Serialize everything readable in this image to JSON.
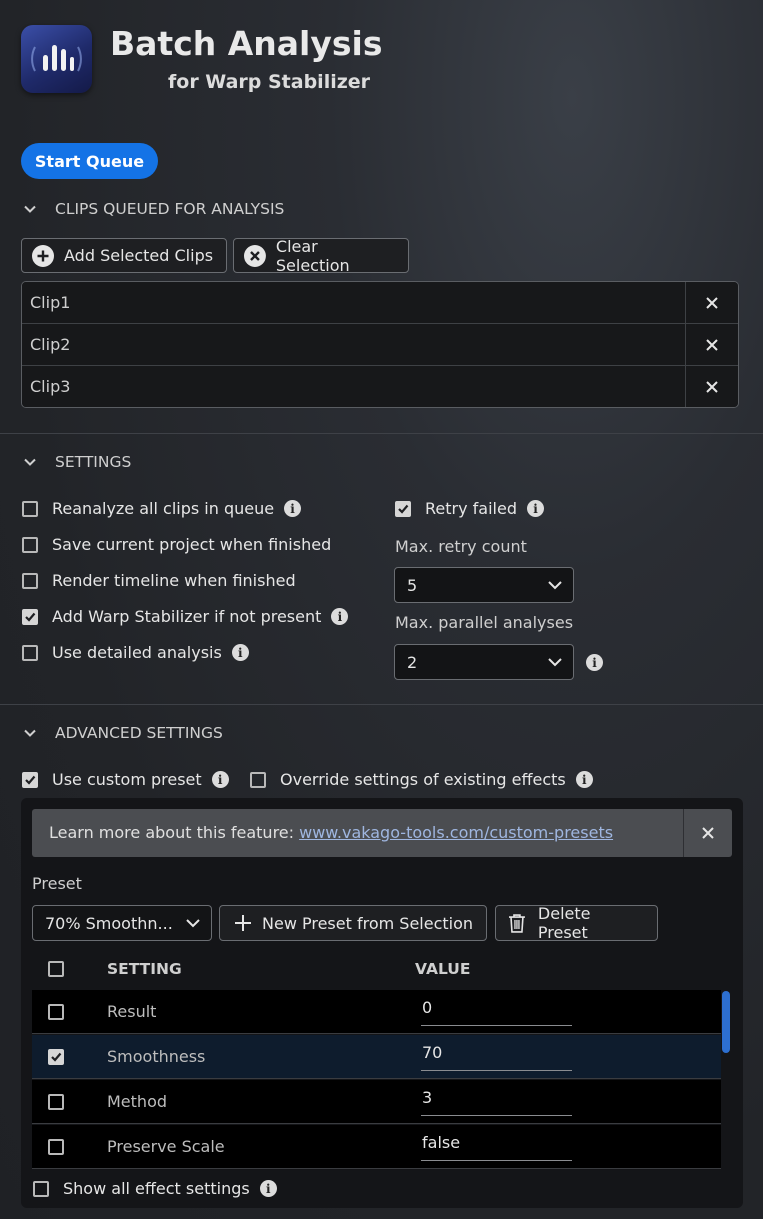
{
  "header": {
    "title": "Batch Analysis",
    "subtitle": "for Warp Stabilizer",
    "logo_icon": "audio-bars-logo"
  },
  "start_queue_label": "Start Queue",
  "clips_section": {
    "title": "CLIPS QUEUED FOR ANALYSIS",
    "add_label": "Add Selected Clips",
    "clear_label": "Clear Selection",
    "clips": [
      "Clip1",
      "Clip2",
      "Clip3"
    ]
  },
  "settings_section": {
    "title": "SETTINGS",
    "options": [
      {
        "label": "Reanalyze all clips in queue",
        "checked": false,
        "info": true
      },
      {
        "label": "Save current project when finished",
        "checked": false,
        "info": false
      },
      {
        "label": "Render timeline when finished",
        "checked": false,
        "info": false
      },
      {
        "label": "Add Warp Stabilizer if not present",
        "checked": true,
        "info": true
      },
      {
        "label": "Use detailed analysis",
        "checked": false,
        "info": true
      }
    ],
    "retry_failed": {
      "label": "Retry failed",
      "checked": true
    },
    "max_retry_label": "Max. retry count",
    "max_retry_value": "5",
    "max_parallel_label": "Max. parallel analyses",
    "max_parallel_value": "2"
  },
  "advanced_section": {
    "title": "ADVANCED SETTINGS",
    "use_custom_preset": {
      "label": "Use custom preset",
      "checked": true
    },
    "override_settings": {
      "label": "Override settings of existing effects",
      "checked": false
    },
    "banner_text": "Learn more about this feature: ",
    "banner_link": "www.vakago-tools.com/custom-presets",
    "preset_label": "Preset",
    "preset_value": "70% Smoothn...",
    "new_preset_label": "New Preset from Selection",
    "delete_preset_label": "Delete Preset",
    "table_headers": {
      "setting": "SETTING",
      "value": "VALUE"
    },
    "rows": [
      {
        "name": "Result",
        "value": "0",
        "checked": false
      },
      {
        "name": "Smoothness",
        "value": "70",
        "checked": true
      },
      {
        "name": "Method",
        "value": "3",
        "checked": false
      },
      {
        "name": "Preserve Scale",
        "value": "false",
        "checked": false
      }
    ],
    "show_all_label": "Show all effect settings"
  },
  "colors": {
    "accent": "#1473e6",
    "background": "#222428"
  }
}
